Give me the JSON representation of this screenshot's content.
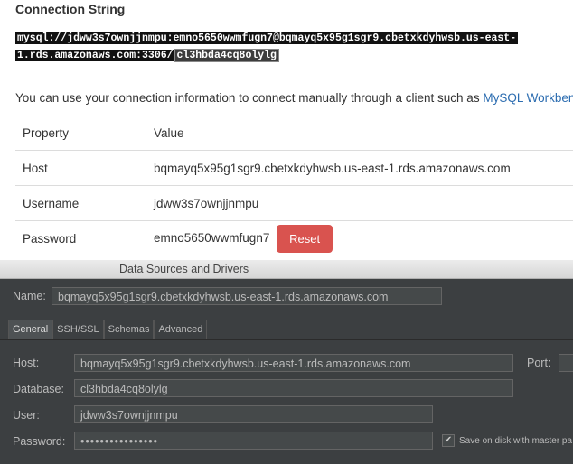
{
  "web": {
    "heading": "Connection String",
    "conn_prefix": "mysql://jdww3s7ownjjnmpu:emno5650wwmfugn7@bqmayq5x95g1sgr9.cbetxkdyhwsb.us-east-",
    "conn_middle": "1.rds.amazonaws.com:3306/",
    "conn_selected": "cl3hbda4cq8olylg",
    "hint_text": "You can use your connection information to connect manually through a client such as ",
    "hint_link": "MySQL Workbench",
    "table": {
      "header": {
        "property": "Property",
        "value": "Value"
      },
      "rows": [
        {
          "property": "Host",
          "value": "bqmayq5x95g1sgr9.cbetxkdyhwsb.us-east-1.rds.amazonaws.com"
        },
        {
          "property": "Username",
          "value": "jdww3s7ownjjnmpu"
        },
        {
          "property": "Password",
          "value": "emno5650wwmfugn7"
        }
      ],
      "reset_label": "Reset"
    }
  },
  "dialog": {
    "title": "Data Sources and Drivers",
    "name_label": "Name:",
    "name_value": "bqmayq5x95g1sgr9.cbetxkdyhwsb.us-east-1.rds.amazonaws.com",
    "tabs": [
      "General",
      "SSH/SSL",
      "Schemas",
      "Advanced"
    ],
    "host_label": "Host:",
    "host_value": "bqmayq5x95g1sgr9.cbetxkdyhwsb.us-east-1.rds.amazonaws.com",
    "port_label": "Port:",
    "database_label": "Database:",
    "database_value": "cl3hbda4cq8olylg",
    "user_label": "User:",
    "user_value": "jdww3s7ownjjnmpu",
    "password_label": "Password:",
    "password_value": "••••••••••••••••",
    "save_label": "Save on disk with master pa"
  }
}
